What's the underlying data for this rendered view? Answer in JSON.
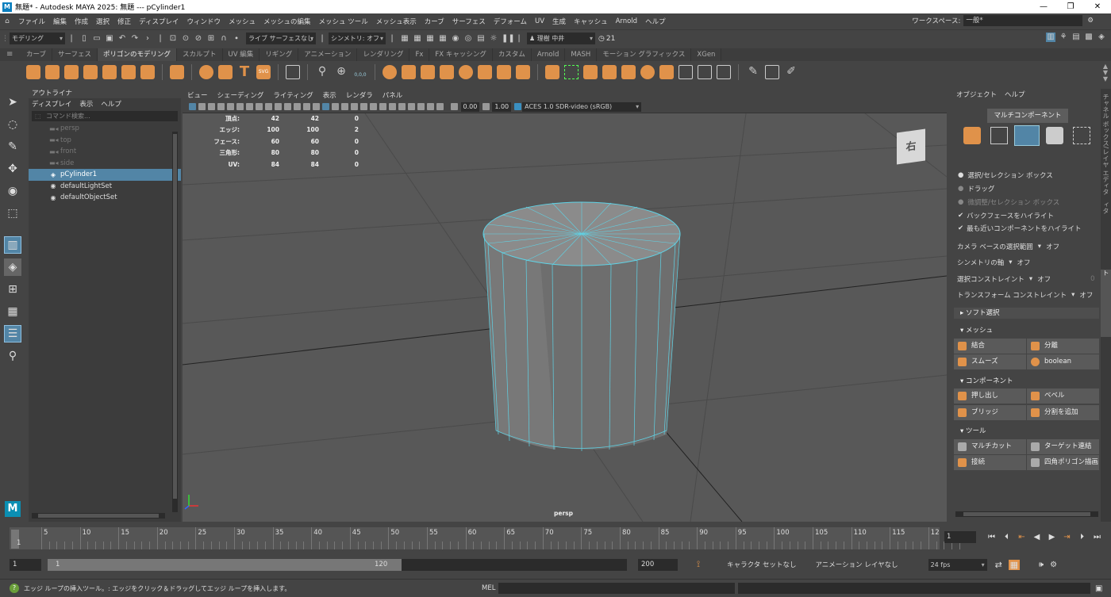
{
  "window": {
    "title": "無題* - Autodesk MAYA 2025: 無題  ---  pCylinder1",
    "app_icon": "M"
  },
  "menu": [
    "ファイル",
    "編集",
    "作成",
    "選択",
    "修正",
    "ディスプレイ",
    "ウィンドウ",
    "メッシュ",
    "メッシュの編集",
    "メッシュ ツール",
    "メッシュ表示",
    "カーブ",
    "サーフェス",
    "デフォーム",
    "UV",
    "生成",
    "キャッシュ",
    "Arnold",
    "ヘルプ"
  ],
  "workspace": {
    "label": "ワークスペース:",
    "value": "一般*"
  },
  "status_line": {
    "mode": "モデリング",
    "live": "ライブ  サーフェスなし",
    "symmetry": "シンメトリ: オフ",
    "user": "理樹 中井",
    "notifications": "21"
  },
  "shelf_tabs": [
    "カーブ",
    "サーフェス",
    "ポリゴンのモデリング",
    "スカルプト",
    "UV 編集",
    "リギング",
    "アニメーション",
    "レンダリング",
    "Fx",
    "FX キャッシング",
    "カスタム",
    "Arnold",
    "MASH",
    "モーション グラフィックス",
    "XGen"
  ],
  "shelf_active": "ポリゴンのモデリング",
  "shelf_text_icons": {
    "text_tool": "T",
    "svg_tool": "SVG",
    "coord": "0,0,0"
  },
  "outliner": {
    "title": "アウトライナ",
    "menu": [
      "ディスプレイ",
      "表示",
      "ヘルプ"
    ],
    "search_placeholder": "コマンド検索...",
    "items": [
      {
        "label": "persp",
        "icon": "camera-icon",
        "dim": true
      },
      {
        "label": "top",
        "icon": "camera-icon",
        "dim": true
      },
      {
        "label": "front",
        "icon": "camera-icon",
        "dim": true
      },
      {
        "label": "side",
        "icon": "camera-icon",
        "dim": true
      },
      {
        "label": "pCylinder1",
        "icon": "mesh-icon",
        "selected": true
      },
      {
        "label": "defaultLightSet",
        "icon": "set-icon"
      },
      {
        "label": "defaultObjectSet",
        "icon": "set-icon"
      }
    ]
  },
  "viewport": {
    "menu": [
      "ビュー",
      "シェーディング",
      "ライティング",
      "表示",
      "レンダラ",
      "パネル"
    ],
    "exposure": "0.00",
    "gamma": "1.00",
    "colorspace": "ACES 1.0 SDR-video (sRGB)",
    "camera": "persp",
    "viewcube": "右",
    "hud": [
      {
        "label": "頂点:",
        "a": "42",
        "b": "42",
        "c": "0"
      },
      {
        "label": "エッジ:",
        "a": "100",
        "b": "100",
        "c": "2"
      },
      {
        "label": "フェース:",
        "a": "60",
        "b": "60",
        "c": "0"
      },
      {
        "label": "三角形:",
        "a": "80",
        "b": "80",
        "c": "0"
      },
      {
        "label": "UV:",
        "a": "84",
        "b": "84",
        "c": "0"
      }
    ]
  },
  "modeling_toolkit": {
    "menu": [
      "オブジェクト",
      "ヘルプ"
    ],
    "multi_component": "マルチコンポーネント",
    "options": {
      "select_box": "選択/セレクション ボックス",
      "drag": "ドラッグ",
      "tweak": "微調整/セレクション ボックス",
      "backface": "バックフェースをハイライト",
      "nearest": "最も近いコンポーネントをハイライト"
    },
    "camera_based": {
      "label": "カメラ ベースの選択範囲",
      "value": "オフ"
    },
    "symmetry_axis": {
      "label": "シンメトリの軸",
      "value": "オフ"
    },
    "select_constraint": {
      "label": "選択コンストレイント",
      "value": "オフ",
      "num": "0"
    },
    "transform_constraint": {
      "label": "トランスフォーム コンストレイント",
      "value": "オフ"
    },
    "soft_select": "ソフト選択",
    "mesh_section": "メッシュ",
    "mesh_buttons": [
      "結合",
      "分離",
      "スムーズ",
      "boolean"
    ],
    "component_section": "コンポーネント",
    "component_buttons": [
      "押し出し",
      "ベベル",
      "ブリッジ",
      "分割を追加"
    ],
    "tool_section": "ツール",
    "tool_buttons": [
      "マルチカット",
      "ターゲット連結",
      "接続",
      "四角ポリゴン描画"
    ]
  },
  "side_tabs": [
    "チャネル ボックス/レイヤ エディタ",
    "アトリビュート エディタ",
    "モデリング ツールキット"
  ],
  "timeline": {
    "ticks": [
      "1",
      "5",
      "10",
      "15",
      "20",
      "25",
      "30",
      "35",
      "40",
      "45",
      "50",
      "55",
      "60",
      "65",
      "70",
      "75",
      "80",
      "85",
      "90",
      "95",
      "100",
      "105",
      "110",
      "115",
      "12"
    ],
    "current": "1"
  },
  "range": {
    "start": "1",
    "inner_start": "1",
    "inner_end": "120",
    "end": "200",
    "char_set": "キャラクタ セットなし",
    "anim_layer": "アニメーション レイヤなし",
    "fps": "24 fps"
  },
  "help": {
    "text": "エッジ ループの挿入ツール。: エッジをクリック＆ドラッグしてエッジ ループを挿入します。",
    "mel": "MEL"
  },
  "maya_logo": "M",
  "colors": {
    "accent": "#5285a6",
    "shelf_orange": "#e0924a",
    "wire": "#5fd3e6"
  }
}
